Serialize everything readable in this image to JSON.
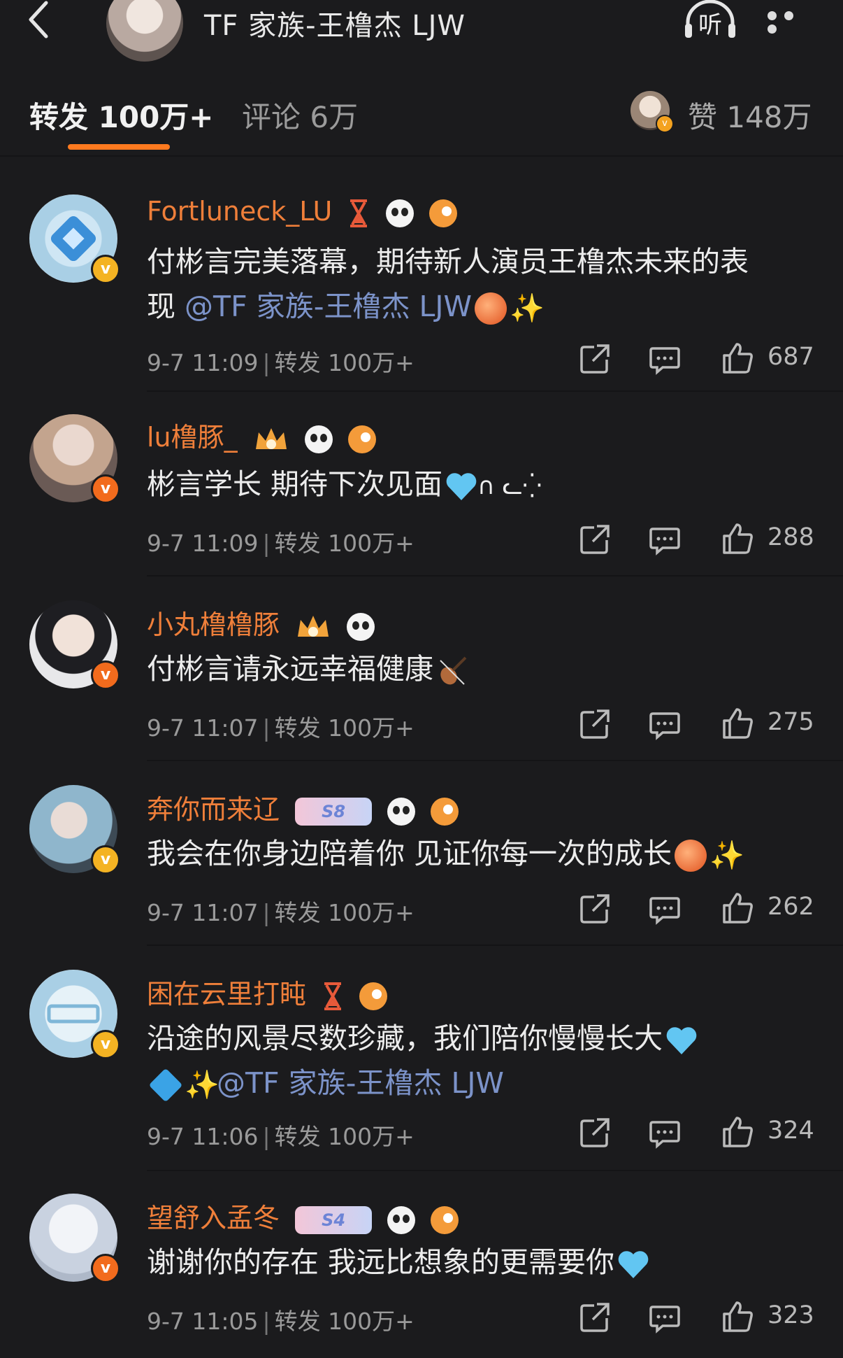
{
  "header": {
    "title": "TF 家族-王橹杰 LJW",
    "listen_label": "听"
  },
  "tabs": {
    "repost": "转发 100万+",
    "comments": "评论 6万",
    "likes": "赞 148万"
  },
  "comments": [
    {
      "name": "Fortluneck_LU",
      "text_line1": "付彬言完美落幕，期待新人演员王橹杰未来的表",
      "text_line2_prefix": "现 ",
      "mention": "@TF 家族-王橹杰 LJW",
      "time": "9-7 11:09",
      "repost": "转发 100万+",
      "likes": "687"
    },
    {
      "name": "lu橹豚_",
      "text": "彬言学长 期待下次见面",
      "kaomoji": "∩ ᓚ⁛",
      "time": "9-7 11:09",
      "repost": "转发 100万+",
      "likes": "288"
    },
    {
      "name": "小丸橹橹豚",
      "text": "付彬言请永远幸福健康",
      "time": "9-7 11:07",
      "repost": "转发 100万+",
      "likes": "275"
    },
    {
      "name": "奔你而来辽",
      "level": "S8",
      "text": "我会在你身边陪着你 见证你每一次的成长",
      "time": "9-7 11:07",
      "repost": "转发 100万+",
      "likes": "262"
    },
    {
      "name": "困在云里打盹",
      "text_line1": "沿途的风景尽数珍藏，我们陪你慢慢长大",
      "mention": "@TF 家族-王橹杰 LJW",
      "time": "9-7 11:06",
      "repost": "转发 100万+",
      "likes": "324"
    },
    {
      "name": "望舒入孟冬",
      "level": "S4",
      "text": "谢谢你的存在 我远比想象的更需要你",
      "time": "9-7 11:05",
      "repost": "转发 100万+",
      "likes": "323"
    }
  ],
  "colors": {
    "background": "#1b1b1d",
    "accent": "#ff7a1f",
    "username": "#ef7f3a",
    "mention": "#7c93c9"
  }
}
